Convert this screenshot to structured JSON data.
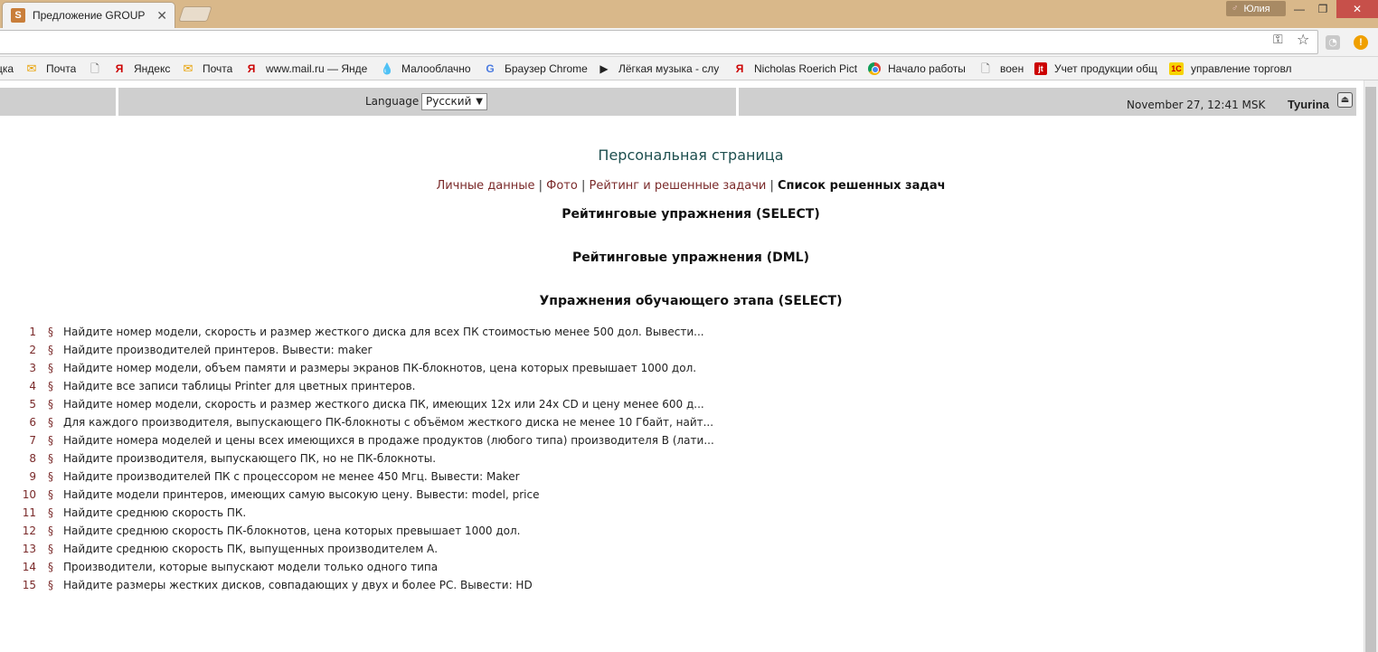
{
  "browser": {
    "tab_title": "Предложение GROUP B",
    "tab_favicon": "S",
    "user_badge": "Юлия"
  },
  "bookmarks": [
    {
      "label": "цка",
      "icon": "partial"
    },
    {
      "label": "Почта",
      "icon": "mail-icon"
    },
    {
      "label": "",
      "icon": "doc-icon"
    },
    {
      "label": "Яндекс",
      "icon": "yandex-icon"
    },
    {
      "label": "Почта",
      "icon": "mail-icon"
    },
    {
      "label": "www.mail.ru — Янде",
      "icon": "yandex-icon"
    },
    {
      "label": "Малооблачно",
      "icon": "weather-icon"
    },
    {
      "label": "Браузер Chrome",
      "icon": "google-icon"
    },
    {
      "label": "Лёгкая музыка - слу",
      "icon": "play-icon"
    },
    {
      "label": "Nicholas Roerich Pict",
      "icon": "yandex-icon"
    },
    {
      "label": "Начало работы",
      "icon": "chrome-icon"
    },
    {
      "label": "воен",
      "icon": "doc-icon"
    },
    {
      "label": "Учет продукции общ",
      "icon": "jt-icon"
    },
    {
      "label": "управление торговл",
      "icon": "1c-icon"
    }
  ],
  "header": {
    "language_label": "Language",
    "language_value": "Русский",
    "datetime": "November 27, 12:41 MSK",
    "username": "Tyurina"
  },
  "page": {
    "title": "Персональная страница",
    "nav": {
      "personal": "Личные данные",
      "photo": "Фото",
      "rating": "Рейтинг и решенные задачи",
      "solved_list": "Список решенных задач",
      "sep": "|"
    },
    "sections": {
      "rating_select": "Рейтинговые упражнения (SELECT)",
      "rating_dml": "Рейтинговые упражнения (DML)",
      "training_select": "Упражнения обучающего этапа (SELECT)"
    },
    "section_mark": "§",
    "tasks": [
      {
        "num": "1",
        "text": "Найдите номер модели, скорость и размер жесткого диска для всех ПК стоимостью менее 500 дол. Вывести..."
      },
      {
        "num": "2",
        "text": "Найдите производителей принтеров. Вывести: maker"
      },
      {
        "num": "3",
        "text": "Найдите номер модели, объем памяти и размеры экранов ПК-блокнотов, цена которых превышает 1000 дол."
      },
      {
        "num": "4",
        "text": "Найдите все записи таблицы Printer для цветных принтеров."
      },
      {
        "num": "5",
        "text": "Найдите номер модели, скорость и размер жесткого диска ПК, имеющих 12x или 24x CD и цену менее 600 д..."
      },
      {
        "num": "6",
        "text": "Для каждого производителя, выпускающего ПК-блокноты c объёмом жесткого диска не менее 10 Гбайт, найт..."
      },
      {
        "num": "7",
        "text": "Найдите номера моделей и цены всех имеющихся в продаже продуктов (любого типа) производителя B (лати..."
      },
      {
        "num": "8",
        "text": "Найдите производителя, выпускающего ПК, но не ПК-блокноты."
      },
      {
        "num": "9",
        "text": "Найдите производителей ПК с процессором не менее 450 Мгц. Вывести: Maker"
      },
      {
        "num": "10",
        "text": "Найдите модели принтеров, имеющих самую высокую цену. Вывести: model, price"
      },
      {
        "num": "11",
        "text": "Найдите среднюю скорость ПК."
      },
      {
        "num": "12",
        "text": "Найдите среднюю скорость ПК-блокнотов, цена которых превышает 1000 дол."
      },
      {
        "num": "13",
        "text": "Найдите среднюю скорость ПК, выпущенных производителем А."
      },
      {
        "num": "14",
        "text": "Производители, которые выпускают модели только одного типа"
      },
      {
        "num": "15",
        "text": "Найдите размеры жестких дисков, совпадающих у двух и более PC. Вывести: HD"
      }
    ]
  },
  "colors": {
    "link": "#7a2a2a",
    "title": "#1e4f4f",
    "titlebar": "#d9b88a",
    "header_strip": "#cfcfcf"
  }
}
